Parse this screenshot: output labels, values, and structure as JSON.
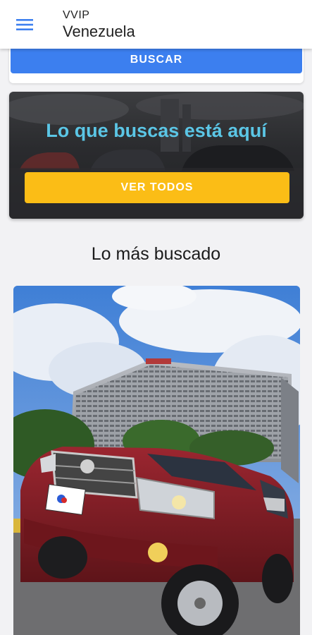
{
  "appbar": {
    "subtitle": "VVIP",
    "title": "Venezuela",
    "menu_icon": "hamburger-menu-icon"
  },
  "search": {
    "button_label": "BUSCAR"
  },
  "promo": {
    "headline": "Lo que buscas está aquí",
    "button_label": "VER TODOS"
  },
  "featured": {
    "section_title": "Lo más buscado"
  },
  "colors": {
    "primary": "#3c7fef",
    "accent": "#fbbd16",
    "headline": "#5bc6e6"
  }
}
